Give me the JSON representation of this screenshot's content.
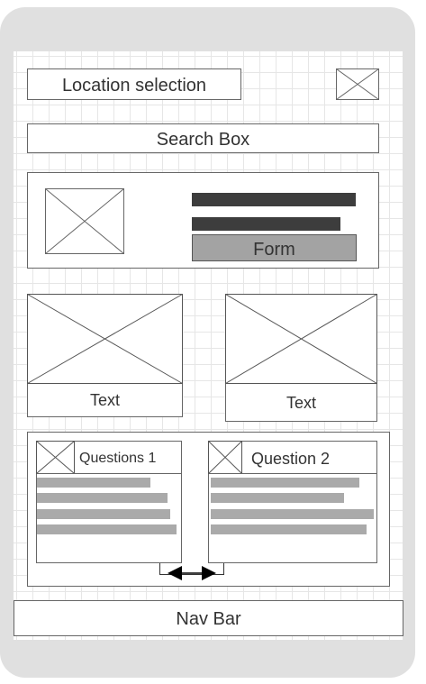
{
  "header": {
    "location_label": "Location selection",
    "location_icon": "image-placeholder-icon"
  },
  "search": {
    "label": "Search Box"
  },
  "form_card": {
    "image_icon": "image-placeholder-icon",
    "form_label": "Form"
  },
  "tiles": [
    {
      "text": "Text",
      "image_icon": "image-placeholder-icon"
    },
    {
      "text": "Text",
      "image_icon": "image-placeholder-icon"
    }
  ],
  "questions": [
    {
      "title": "Questions 1",
      "icon": "image-placeholder-icon"
    },
    {
      "title": "Question 2",
      "icon": "image-placeholder-icon"
    }
  ],
  "carousel": {
    "prev_icon": "arrow-left-icon",
    "next_icon": "arrow-right-icon"
  },
  "nav": {
    "label": "Nav Bar"
  },
  "colors": {
    "device_frame": "#e0e0e0",
    "grid_line": "#e6e6e6",
    "outline": "#666666",
    "dark_bar": "#3d3d3d",
    "light_bar": "#aaaaaa",
    "form_fill": "#a3a3a3"
  }
}
